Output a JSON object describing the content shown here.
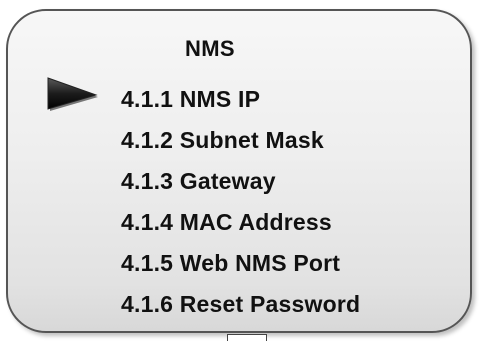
{
  "menu": {
    "title": "NMS",
    "selected_index": 0,
    "items": [
      {
        "label": "4.1.1 NMS IP"
      },
      {
        "label": "4.1.2 Subnet Mask"
      },
      {
        "label": "4.1.3 Gateway"
      },
      {
        "label": "4.1.4 MAC Address"
      },
      {
        "label": "4.1.5 Web NMS Port"
      },
      {
        "label": "4.1.6 Reset Password"
      }
    ]
  },
  "icons": {
    "pointer": "triangle-pointer-icon"
  },
  "colors": {
    "text": "#111111",
    "panel_border": "#555555",
    "pointer_fill": "#1a1a1a"
  }
}
